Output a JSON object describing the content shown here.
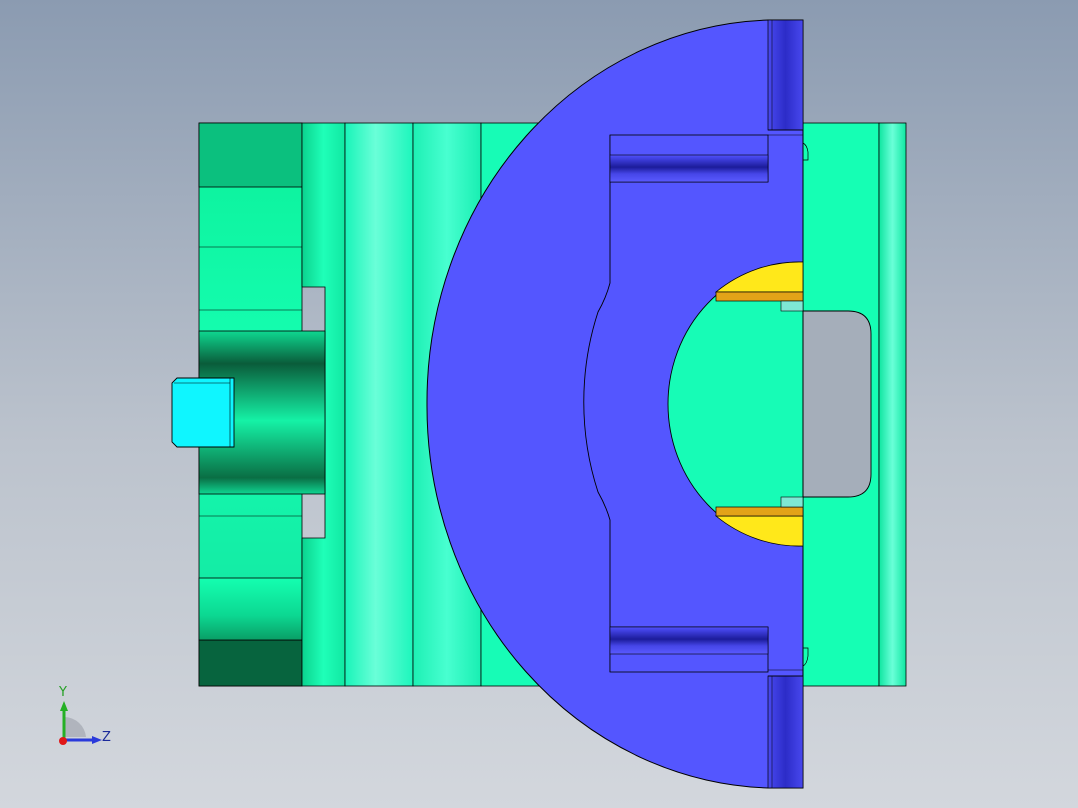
{
  "axes": {
    "y_label": "Y",
    "z_label": "Z"
  },
  "colors": {
    "background_top": "#8b9bb1",
    "background_bottom": "#d3d7dd",
    "green_part": "#15ffb4",
    "blue_part": "#5456ff",
    "yellow_part": "#ffe81a",
    "cyan_part": "#0ff6ff"
  }
}
